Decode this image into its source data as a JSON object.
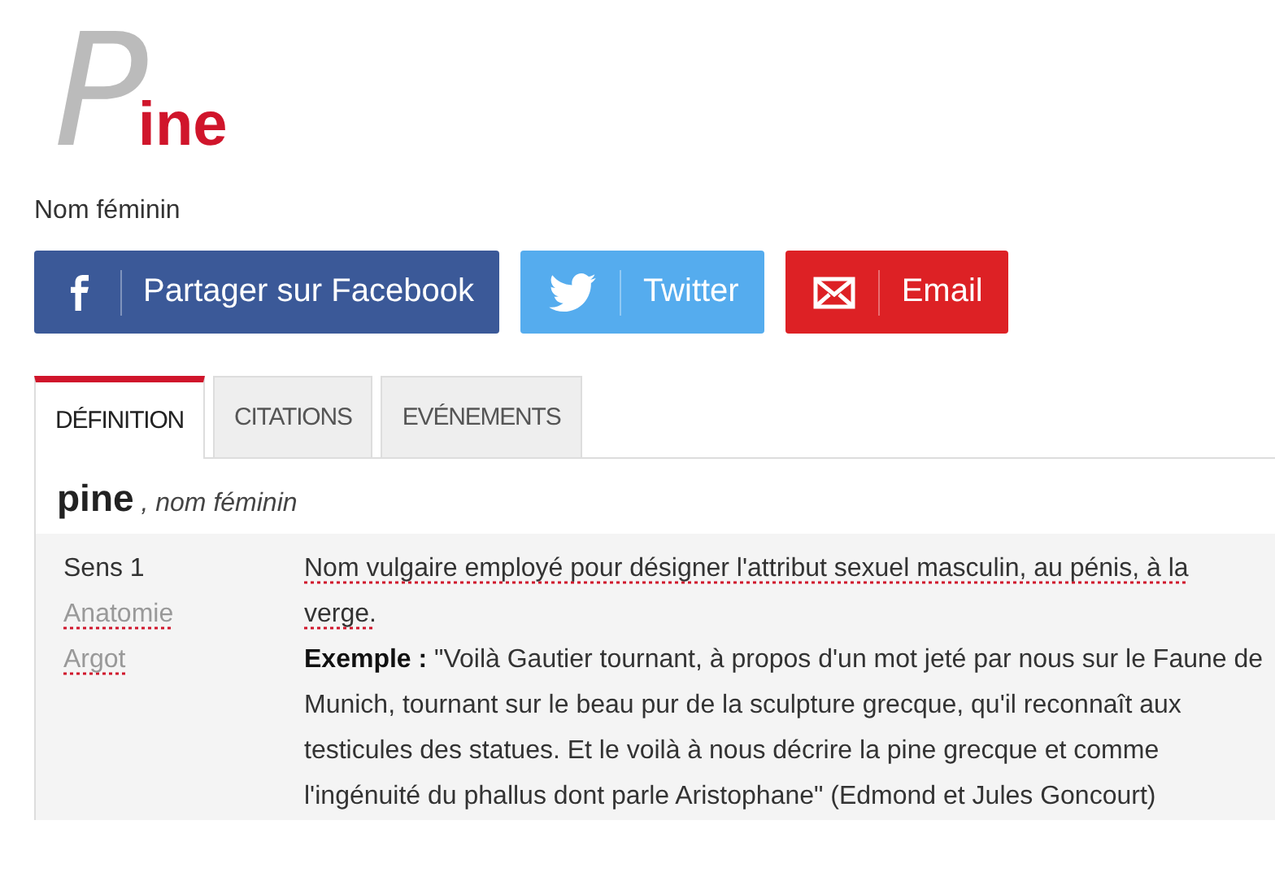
{
  "title": "Pine",
  "subtitle": "Nom féminin",
  "share_buttons": [
    {
      "kind": "facebook",
      "label": "Partager sur Facebook"
    },
    {
      "kind": "twitter",
      "label": "Twitter"
    },
    {
      "kind": "email",
      "label": "Email"
    }
  ],
  "tabs": [
    {
      "label": "DÉFINITION",
      "selected": true
    },
    {
      "label": "CITATIONS",
      "selected": false
    },
    {
      "label": "EVÉNEMENTS",
      "selected": false
    }
  ],
  "entry": {
    "word": "pine",
    "grammar": ", nom féminin"
  },
  "senses": [
    {
      "labels": [
        {
          "text": "Sens 1",
          "kind": "plain"
        },
        {
          "text": "Anatomie",
          "kind": "link"
        },
        {
          "text": "Argot",
          "kind": "link"
        }
      ],
      "definition": "Nom vulgaire employé pour désigner l'attribut sexuel masculin, au pénis, à la verge.",
      "example": "**Exemple :** \"Voilà Gautier tournant, à propos d'un mot jeté par nous sur le Faune de Munich, tournant sur le beau pur de la sculpture grecque, qu'il reconnaît aux testicules des statues. Et le voilà à nous décrire la pine grecque et comme l'ingénuité du phallus dont parle Aristophane\" (Edmond et Jules Goncourt)"
    }
  ]
}
